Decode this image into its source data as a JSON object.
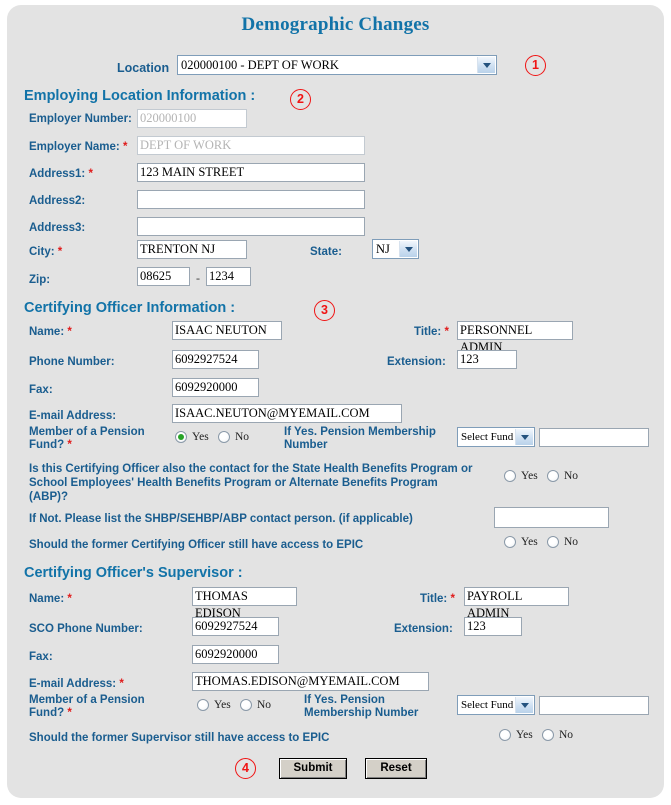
{
  "page": {
    "title": "Demographic Changes"
  },
  "location": {
    "label": "Location",
    "value": "020000100 - DEPT OF WORK",
    "marker": "1"
  },
  "employing_location": {
    "heading": "Employing Location Information :",
    "marker": "2",
    "employer_number": {
      "label": "Employer Number:",
      "value": "020000100"
    },
    "employer_name": {
      "label": "Employer Name:",
      "required": "*",
      "value": "DEPT OF WORK"
    },
    "address1": {
      "label": "Address1:",
      "required": "*",
      "value": "123 MAIN  STREET"
    },
    "address2": {
      "label": "Address2:",
      "value": ""
    },
    "address3": {
      "label": "Address3:",
      "value": ""
    },
    "city": {
      "label": "City:",
      "required": "*",
      "value": "TRENTON  NJ"
    },
    "state": {
      "label": "State:",
      "value": "NJ"
    },
    "zip": {
      "label": "Zip:",
      "value": "08625",
      "separator": "-",
      "plus4": "1234"
    }
  },
  "certifying_officer": {
    "heading": "Certifying Officer Information :",
    "marker": "3",
    "name": {
      "label": "Name:",
      "required": "*",
      "value": "ISAAC NEUTON"
    },
    "title": {
      "label": "Title:",
      "required": "*",
      "value": "PERSONNEL ADMIN"
    },
    "phone": {
      "label": "Phone Number:",
      "value": "6092927524"
    },
    "extension": {
      "label": "Extension:",
      "value": "123"
    },
    "fax": {
      "label": "Fax:",
      "value": "6092920000"
    },
    "email": {
      "label": "E-mail Address:",
      "value": "ISAAC.NEUTON@MYEMAIL.COM"
    },
    "pension": {
      "label_line1": "Member of a Pension",
      "label_line2": "Fund?",
      "required": "*",
      "yes": "Yes",
      "no": "No",
      "selected": "Yes"
    },
    "pension_number": {
      "label_line1": "If Yes. Pension Membership",
      "label_line2": "Number",
      "fund_select": "Select Fund",
      "value": ""
    },
    "shbp_question": {
      "line1": "Is this Certifying Officer also the contact for the State Health Benefits Program or",
      "line2": "School Employees' Health Benefits Program or Alternate Benefits Program",
      "line3": "(ABP)?",
      "yes": "Yes",
      "no": "No",
      "selected": ""
    },
    "shbp_contact": {
      "label": "If Not. Please list the SHBP/SEHBP/ABP contact person. (if applicable)",
      "value": ""
    },
    "epic_access": {
      "label": "Should the former Certifying Officer still have access to EPIC",
      "yes": "Yes",
      "no": "No",
      "selected": ""
    }
  },
  "supervisor": {
    "heading": "Certifying Officer's Supervisor :",
    "name": {
      "label": "Name:",
      "required": "*",
      "value": "THOMAS EDISON"
    },
    "title": {
      "label": "Title:",
      "required": "*",
      "value": "PAYROLL ADMIN"
    },
    "phone": {
      "label": "SCO Phone Number:",
      "value": "6092927524"
    },
    "extension": {
      "label": "Extension:",
      "value": "123"
    },
    "fax": {
      "label": "Fax:",
      "value": "6092920000"
    },
    "email": {
      "label": "E-mail Address:",
      "required": "*",
      "value": "THOMAS.EDISON@MYEMAIL.COM"
    },
    "pension": {
      "label_line1": "Member of a Pension",
      "label_line2": "Fund?",
      "required": "*",
      "yes": "Yes",
      "no": "No",
      "selected": ""
    },
    "pension_number": {
      "label_line1": "If Yes. Pension",
      "label_line2": "Membership Number",
      "fund_select": "Select Fund",
      "value": ""
    },
    "epic_access": {
      "label": "Should the former Supervisor still have access to EPIC",
      "yes": "Yes",
      "no": "No",
      "selected": ""
    }
  },
  "actions": {
    "marker": "4",
    "submit": "Submit",
    "reset": "Reset"
  },
  "colors": {
    "panel_bg": "#e3e3e3",
    "heading": "#1273a8",
    "label": "#1a5d8f",
    "required": "#e01b1b",
    "marker": "#f01414",
    "radio_selected": "#27a327"
  }
}
